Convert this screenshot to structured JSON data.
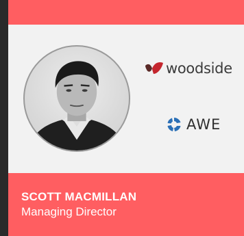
{
  "profile": {
    "name": "SCOTT MACMILLAN",
    "role": "Managing Director"
  },
  "logos": {
    "woodside": {
      "text": "woodside",
      "icon": "woodside-logo-icon"
    },
    "awe": {
      "text": "AWE",
      "icon": "awe-logo-icon"
    }
  },
  "colors": {
    "accent": "#ff5e61",
    "card_bg": "#f2f2f2",
    "page_bg": "#2a2a2a",
    "awe_blue": "#2a6fb6",
    "woodside_red": "#c4262e",
    "woodside_dark": "#5a2a27"
  }
}
